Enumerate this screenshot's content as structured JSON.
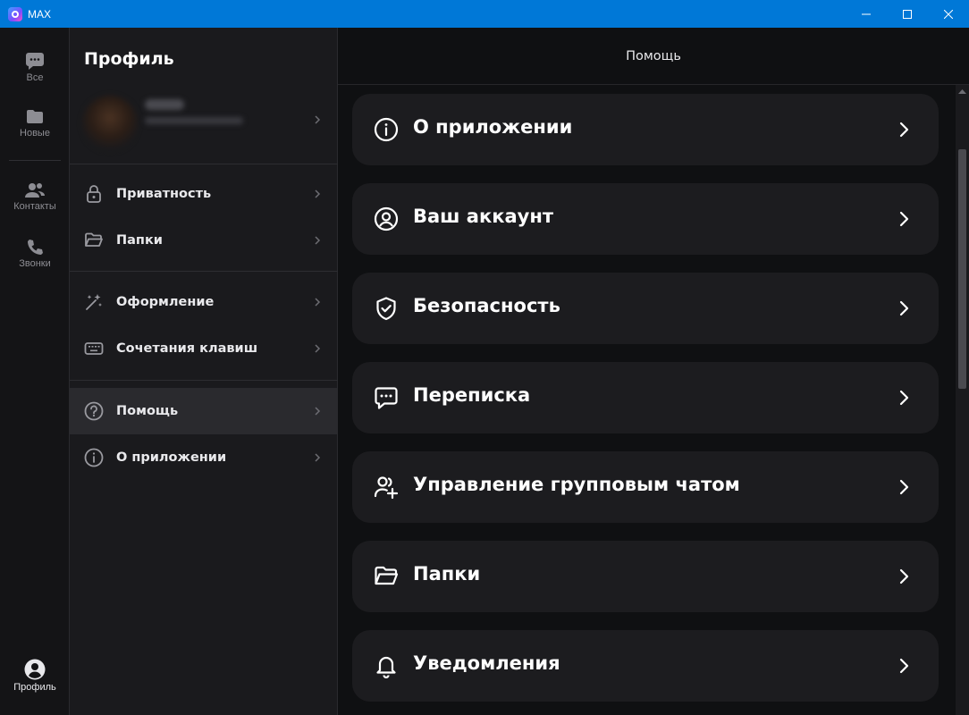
{
  "window": {
    "title": "MAX"
  },
  "rail": {
    "items": [
      {
        "label": "Все",
        "icon": "chat-bubble-icon"
      },
      {
        "label": "Новые",
        "icon": "folder-icon"
      },
      {
        "label": "Контакты",
        "icon": "contacts-icon"
      },
      {
        "label": "Звонки",
        "icon": "phone-icon"
      }
    ],
    "profile": {
      "label": "Профиль",
      "icon": "profile-icon"
    }
  },
  "settings": {
    "title": "Профиль",
    "items": [
      {
        "label": "Приватность",
        "icon": "lock-icon"
      },
      {
        "label": "Папки",
        "icon": "folder-open-icon"
      },
      {
        "label": "Оформление",
        "icon": "magic-wand-icon"
      },
      {
        "label": "Сочетания клавиш",
        "icon": "keyboard-icon"
      },
      {
        "label": "Помощь",
        "icon": "help-icon",
        "active": true
      },
      {
        "label": "О приложении",
        "icon": "info-icon"
      }
    ]
  },
  "main": {
    "title": "Помощь",
    "cards": [
      {
        "label": "О приложении",
        "icon": "info-icon"
      },
      {
        "label": "Ваш аккаунт",
        "icon": "account-icon"
      },
      {
        "label": "Безопасность",
        "icon": "shield-check-icon"
      },
      {
        "label": "Переписка",
        "icon": "chat-dots-icon"
      },
      {
        "label": "Управление групповым чатом",
        "icon": "group-add-icon"
      },
      {
        "label": "Папки",
        "icon": "folder-open-icon"
      },
      {
        "label": "Уведомления",
        "icon": "bell-icon"
      }
    ]
  },
  "colors": {
    "titlebar": "#0078d7",
    "background": "#0f1012",
    "card": "#1c1c1f",
    "active_item": "#2a2a2e"
  }
}
